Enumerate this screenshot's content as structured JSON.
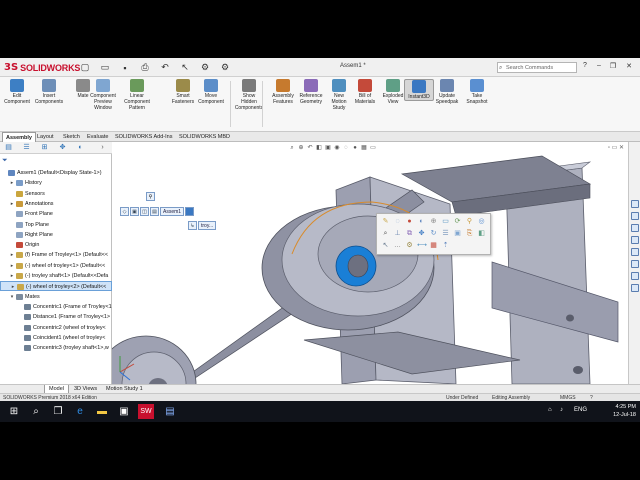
{
  "app": {
    "brand": "SOLIDWORKS",
    "document_title": "Assem1 *",
    "search_placeholder": "Search Commands"
  },
  "quick_access": [
    "new-icon",
    "open-icon",
    "save-icon",
    "print-icon",
    "undo-icon",
    "select-icon",
    "rebuild-icon",
    "options-icon"
  ],
  "ribbon": {
    "buttons": [
      {
        "label": "Edit\nComponent",
        "icon": "edit-component-icon",
        "color": "#3d7fc4"
      },
      {
        "label": "Insert\nComponents",
        "icon": "insert-components-icon",
        "color": "#6e8fb8"
      },
      {
        "label": "Mate",
        "icon": "mate-icon",
        "color": "#8a8a8a"
      },
      {
        "label": "Component\nPreview\nWindow",
        "icon": "preview-window-icon",
        "color": "#7fa6d1"
      },
      {
        "label": "Linear Component\nPattern",
        "icon": "linear-pattern-icon",
        "color": "#6a9a5b"
      },
      {
        "label": "Smart\nFasteners",
        "icon": "smart-fasteners-icon",
        "color": "#9b8b4a"
      },
      {
        "label": "Move\nComponent",
        "icon": "move-component-icon",
        "color": "#5c8ec9"
      },
      {
        "label": "Show\nHidden\nComponents",
        "icon": "show-hidden-icon",
        "color": "#7a7a7a"
      },
      {
        "label": "Assembly\nFeatures",
        "icon": "assembly-features-icon",
        "color": "#c67a2e"
      },
      {
        "label": "Reference\nGeometry",
        "icon": "reference-geometry-icon",
        "color": "#8b6bb8"
      },
      {
        "label": "New\nMotion\nStudy",
        "icon": "motion-study-icon",
        "color": "#4f8fbf"
      },
      {
        "label": "Bill of\nMaterials",
        "icon": "bom-icon",
        "color": "#c44a3a"
      },
      {
        "label": "Exploded\nView",
        "icon": "exploded-view-icon",
        "color": "#5f9f86"
      },
      {
        "label": "Instant3D",
        "icon": "instant3d-icon",
        "color": "#3a78c2"
      },
      {
        "label": "Update\nSpeedpak",
        "icon": "speedpak-icon",
        "color": "#6b86b0"
      },
      {
        "label": "Take\nSnapshot",
        "icon": "snapshot-icon",
        "color": "#5a8fd1"
      }
    ]
  },
  "command_tabs": [
    {
      "label": "Assembly",
      "active": true
    },
    {
      "label": "Layout"
    },
    {
      "label": "Sketch"
    },
    {
      "label": "Evaluate"
    },
    {
      "label": "SOLIDWORKS Add-Ins"
    },
    {
      "label": "SOLIDWORKS MBD"
    }
  ],
  "feature_tree": {
    "rows": [
      {
        "label": "Assem1 (Default<Display State-1>)",
        "level": 0,
        "icon": "assembly-icon",
        "color": "#5f86bf"
      },
      {
        "label": "History",
        "level": 1,
        "icon": "history-icon",
        "color": "#7a9cc8",
        "exp": "▸"
      },
      {
        "label": "Sensors",
        "level": 1,
        "icon": "sensors-icon",
        "color": "#caa63e"
      },
      {
        "label": "Annotations",
        "level": 1,
        "icon": "annotations-icon",
        "color": "#c99a3a",
        "exp": "▸"
      },
      {
        "label": "Front Plane",
        "level": 1,
        "icon": "plane-icon",
        "color": "#8ea4c2"
      },
      {
        "label": "Top Plane",
        "level": 1,
        "icon": "plane-icon",
        "color": "#8ea4c2"
      },
      {
        "label": "Right Plane",
        "level": 1,
        "icon": "plane-icon",
        "color": "#8ea4c2"
      },
      {
        "label": "Origin",
        "level": 1,
        "icon": "origin-icon",
        "color": "#c44a3a"
      },
      {
        "label": "(f) Frame of Troyley<1> (Default<<",
        "level": 1,
        "icon": "part-icon",
        "color": "#c9a84a",
        "exp": "▸"
      },
      {
        "label": "(-) wheel of troyley<1> (Default<<",
        "level": 1,
        "icon": "part-icon",
        "color": "#c9a84a",
        "exp": "▸"
      },
      {
        "label": "(-) troyley shaft<1> (Default<<Defa",
        "level": 1,
        "icon": "part-icon",
        "color": "#c9a84a",
        "exp": "▸"
      },
      {
        "label": "(-) wheel of troyley<2> (Default<<",
        "level": 1,
        "icon": "part-icon",
        "color": "#c9a84a",
        "exp": "▸",
        "selected": true
      },
      {
        "label": "Mates",
        "level": 1,
        "icon": "mates-icon",
        "color": "#7b8b9d",
        "exp": "▾"
      },
      {
        "label": "Concentric1 (Frame of Troyley<1",
        "level": 2,
        "icon": "concentric-mate-icon",
        "color": "#6d7f93"
      },
      {
        "label": "Distance1 (Frame of Troyley<1>",
        "level": 2,
        "icon": "distance-mate-icon",
        "color": "#6d7f93"
      },
      {
        "label": "Concentric2 (wheel of troyley<",
        "level": 2,
        "icon": "concentric-mate-icon",
        "color": "#6d7f93"
      },
      {
        "label": "Coincident1 (wheel of troyley<",
        "level": 2,
        "icon": "coincident-mate-icon",
        "color": "#6d7f93"
      },
      {
        "label": "Concentric3 (troyley shaft<1>,w",
        "level": 2,
        "icon": "concentric-mate-icon",
        "color": "#6d7f93"
      }
    ]
  },
  "breadcrumb": {
    "label": "Assem1"
  },
  "breadcrumb2": {
    "label": "troy..."
  },
  "bottom_tabs": [
    {
      "label": "Model",
      "active": true
    },
    {
      "label": "3D Views"
    },
    {
      "label": "Motion Study 1"
    }
  ],
  "status_bar": {
    "product": "SOLIDWORKS Premium 2018 x64 Edition",
    "state": "Under Defined",
    "mode": "Editing Assembly",
    "units": "MMGS"
  },
  "taskbar": {
    "time": "4:25 PM",
    "date": "12-Jul-18",
    "lang": "ENG"
  },
  "colors": {
    "model_gray": "#a6a9b8",
    "model_dark": "#6d7080",
    "highlight_blue": "#1a7fd6",
    "edge_orange": "#d98b2a"
  }
}
